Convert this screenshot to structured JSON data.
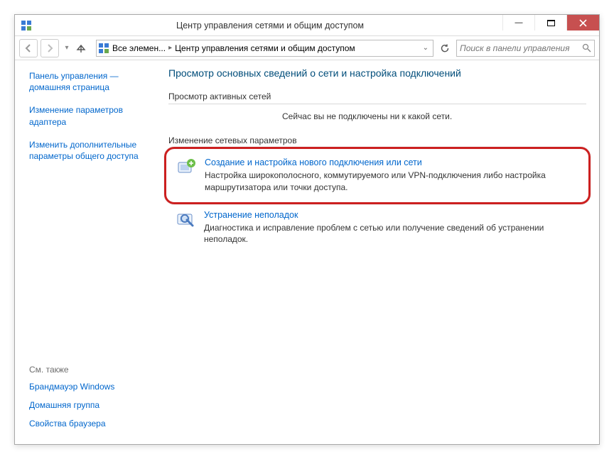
{
  "window": {
    "title": "Центр управления сетями и общим доступом"
  },
  "breadcrumb": {
    "item1": "Все элемен...",
    "item2": "Центр управления сетями и общим доступом"
  },
  "search": {
    "placeholder": "Поиск в панели управления"
  },
  "sidebar": {
    "link1": "Панель управления — домашняя страница",
    "link2": "Изменение параметров адаптера",
    "link3": "Изменить дополнительные параметры общего доступа",
    "see_also_header": "См. также",
    "see1": "Брандмауэр Windows",
    "see2": "Домашняя группа",
    "see3": "Свойства браузера"
  },
  "main": {
    "heading": "Просмотр основных сведений о сети и настройка подключений",
    "active_nets_label": "Просмотр активных сетей",
    "no_network_msg": "Сейчас вы не подключены ни к какой сети.",
    "change_settings_label": "Изменение сетевых параметров",
    "task1": {
      "title": "Создание и настройка нового подключения или сети",
      "desc": "Настройка широкополосного, коммутируемого или VPN-подключения либо настройка маршрутизатора или точки доступа."
    },
    "task2": {
      "title": "Устранение неполадок",
      "desc": "Диагностика и исправление проблем с сетью или получение сведений об устранении неполадок."
    }
  }
}
